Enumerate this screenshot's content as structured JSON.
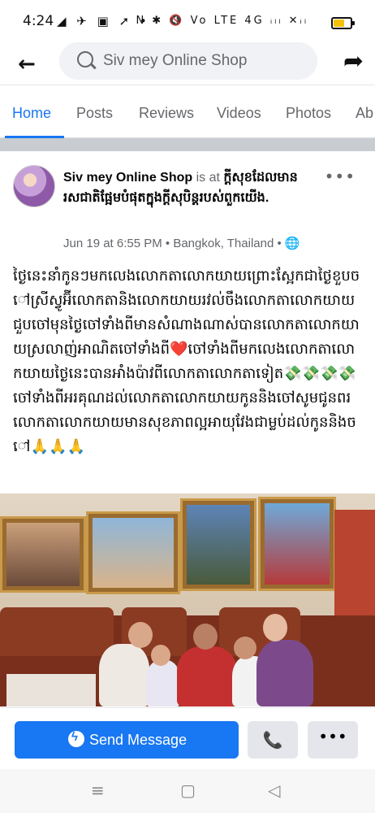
{
  "status_bar": {
    "time": "4:24",
    "left_icons": "◢ ✈ ▣ ➚ •",
    "right_icons": "N ✱ 🔇 Vo LTE 4G ᵢₗₗ ✕ᵢₗ",
    "battery_level": 0.7,
    "battery_color": "#f4c20d"
  },
  "header": {
    "back_icon": "arrow-left-icon",
    "search_query": "Siv mey Online Shop",
    "share_icon": "share-arrow-icon"
  },
  "tabs": [
    {
      "label": "Home",
      "active": true
    },
    {
      "label": "Posts",
      "active": false
    },
    {
      "label": "Reviews",
      "active": false
    },
    {
      "label": "Videos",
      "active": false
    },
    {
      "label": "Photos",
      "active": false
    },
    {
      "label": "Ab",
      "active": false
    }
  ],
  "post": {
    "author": "Siv mey Online Shop",
    "is_at": " is at ",
    "place": "ក្តីសុខដែលមានរសជាតិផ្អែមបំផុតក្នុងក្តីសុបិន្តរបស់ពួកយើង.",
    "date": "Jun 19 at 6:55 PM",
    "location": " • Bangkok, Thailand • ",
    "globe_icon": "globe-icon",
    "text": "ថ្ងៃនេះនាំកូនៗមកលេងលោកតាលោកយាយព្រោះស្អែកជាថ្ងៃខួបចៅស្រីស្វូអ៊ីលោកតានិងលោកយាយរវល់ចឹងលោកតាលោកយាយជួបចៅមុនថ្ងៃចៅទាំងពីមានសំណាងណាស់បានលោកតាលោកយាយស្រលាញ់អាណិតចៅទាំងពី❤️ចៅទាំងពីមកលេងលោកតាលោកយាយថ្ងៃនេះបានអាំងប៉ាវពីលោកតាលោកតាទៀត💸💸💸💸ចៅទាំងពីអរគុណដល់លោកតាលោកយាយកូននិងចៅសូមជូនពរលោកតាលោកយាយមានសុខភាពល្អអាយុវែងជាម្លប់ដល់កូននិងចៅ🙏🙏🙏"
  },
  "actions": {
    "send_message": "Send Message",
    "call_icon": "phone-icon",
    "more_icon": "more-dots-icon",
    "accent": "#1877f2"
  },
  "navbar": {
    "menu_icon": "≡",
    "home_icon": "▢",
    "back_icon": "◁"
  }
}
